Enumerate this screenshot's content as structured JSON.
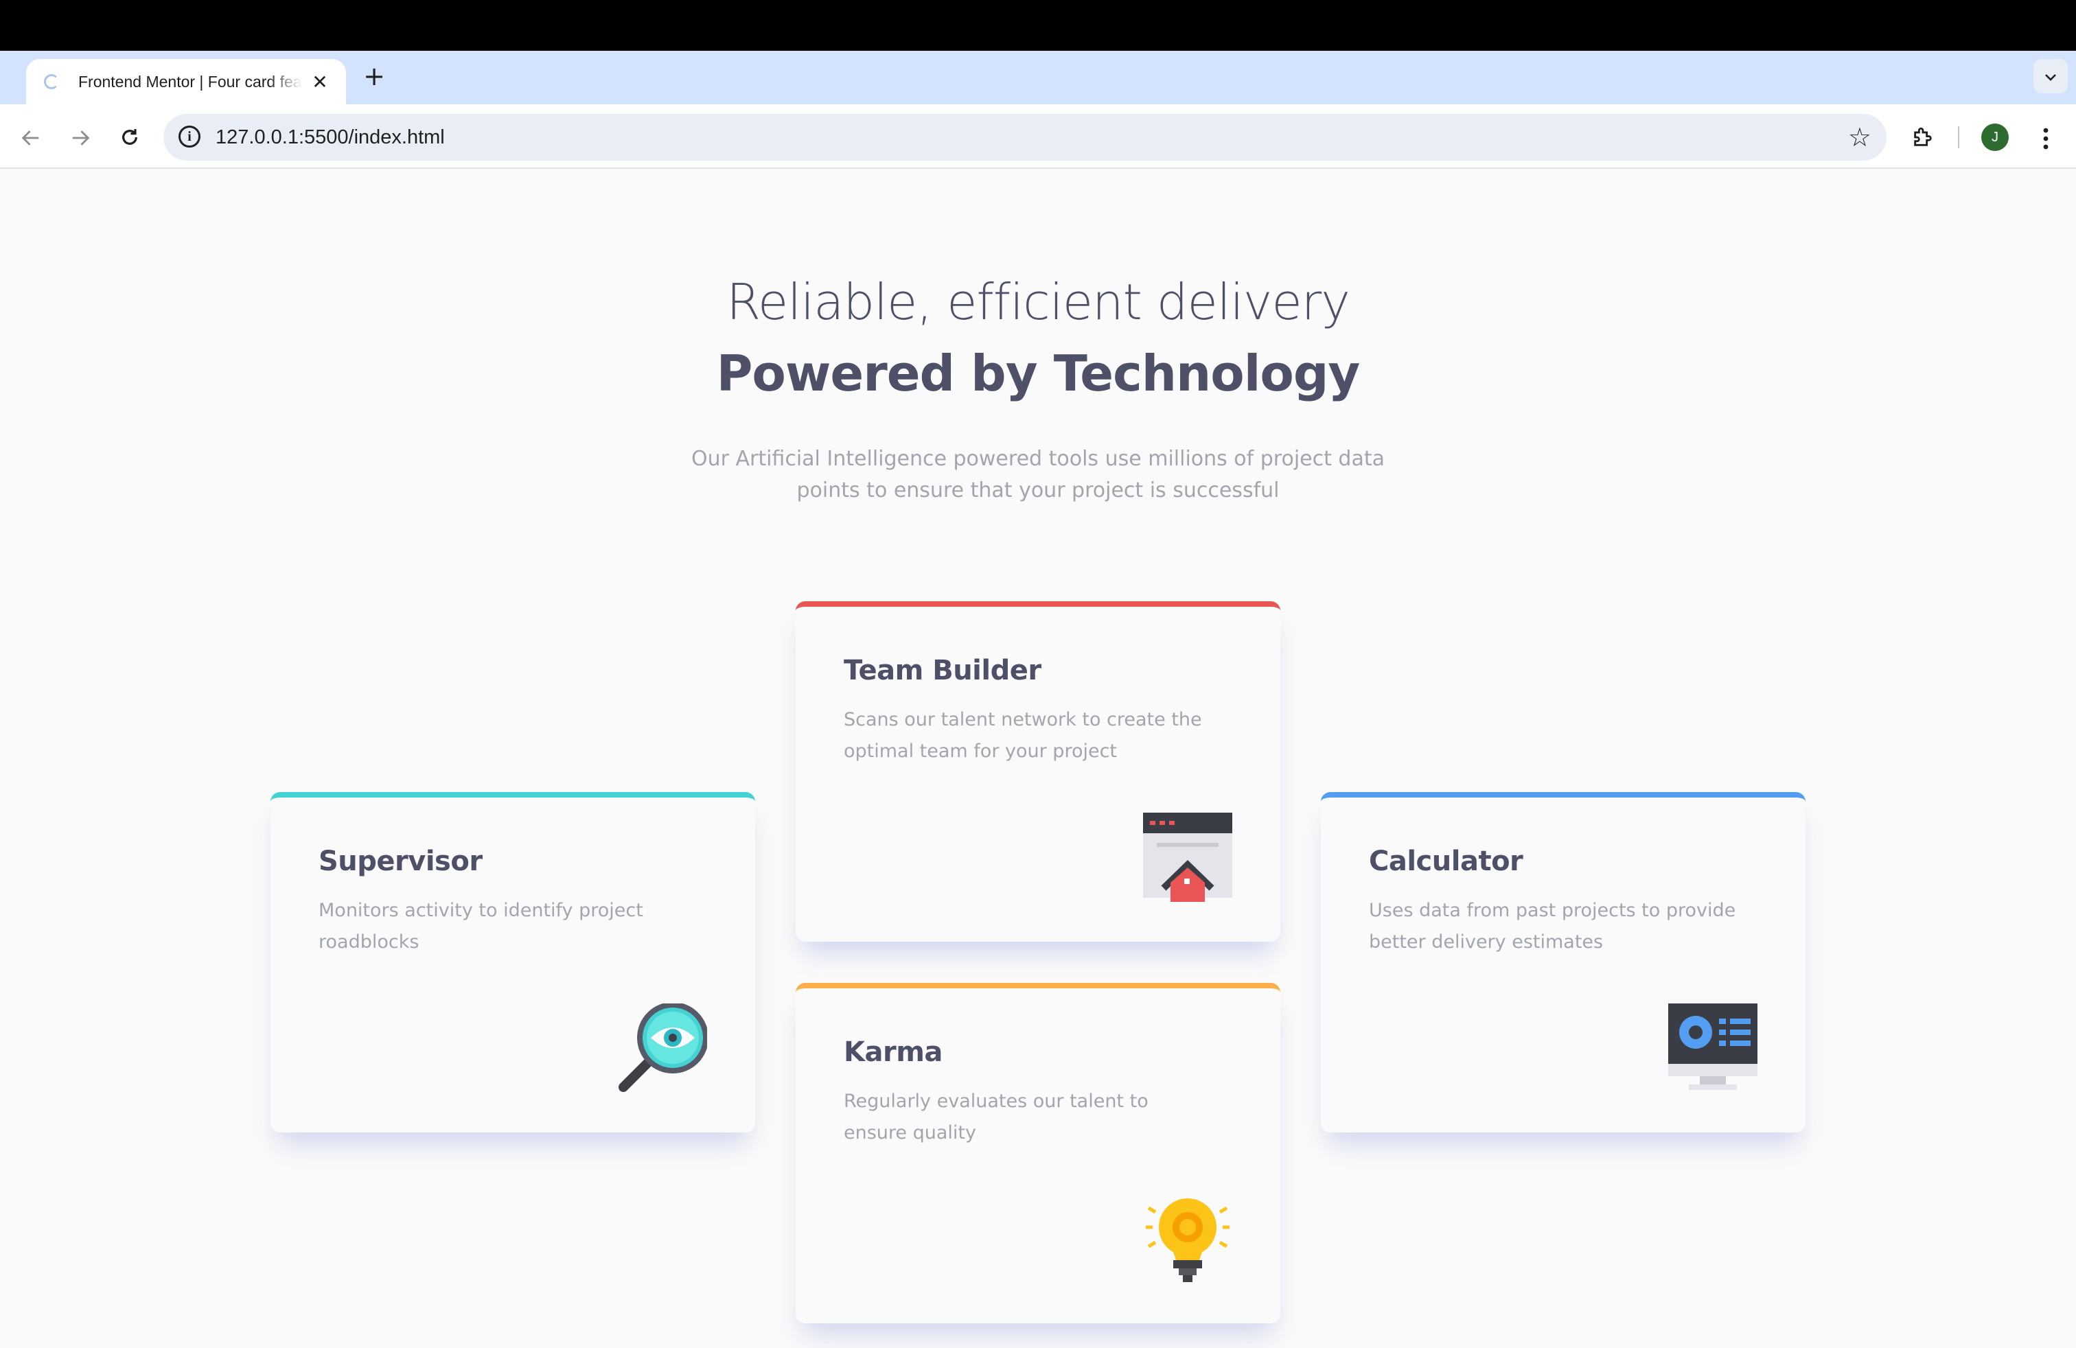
{
  "browser": {
    "tab_title": "Frontend Mentor | Four card feature section",
    "tab_close": "✕",
    "new_tab": "+",
    "url": "127.0.0.1:5500/index.html",
    "avatar_initial": "J",
    "icons": {
      "back": "arrow-left-icon",
      "forward": "arrow-right-icon",
      "reload": "reload-icon",
      "info": "info-icon",
      "star": "star-icon",
      "extensions": "puzzle-icon",
      "menu": "kebab-icon",
      "tab_menu": "chevron-down-icon"
    }
  },
  "hero": {
    "line1": "Reliable, efficient delivery",
    "line2": "Powered by Technology",
    "subtitle": "Our Artificial Intelligence powered tools use millions of project data points to ensure that your project is successful"
  },
  "cards": {
    "supervisor": {
      "title": "Supervisor",
      "text": "Monitors activity to identify project roadblocks",
      "accent": "#44d3d2",
      "icon": "magnifier-eye-icon"
    },
    "team": {
      "title": "Team Builder",
      "text": "Scans our talent network to create the optimal team for your project",
      "accent": "#ea5454",
      "icon": "browser-house-icon"
    },
    "karma": {
      "title": "Karma",
      "text": "Regularly evaluates our talent to ensure quality",
      "accent": "#fcae4a",
      "icon": "lightbulb-icon"
    },
    "calculator": {
      "title": "Calculator",
      "text": "Uses data from past projects to provide better delivery estimates",
      "accent": "#549ef2",
      "icon": "monitor-chart-icon"
    }
  }
}
